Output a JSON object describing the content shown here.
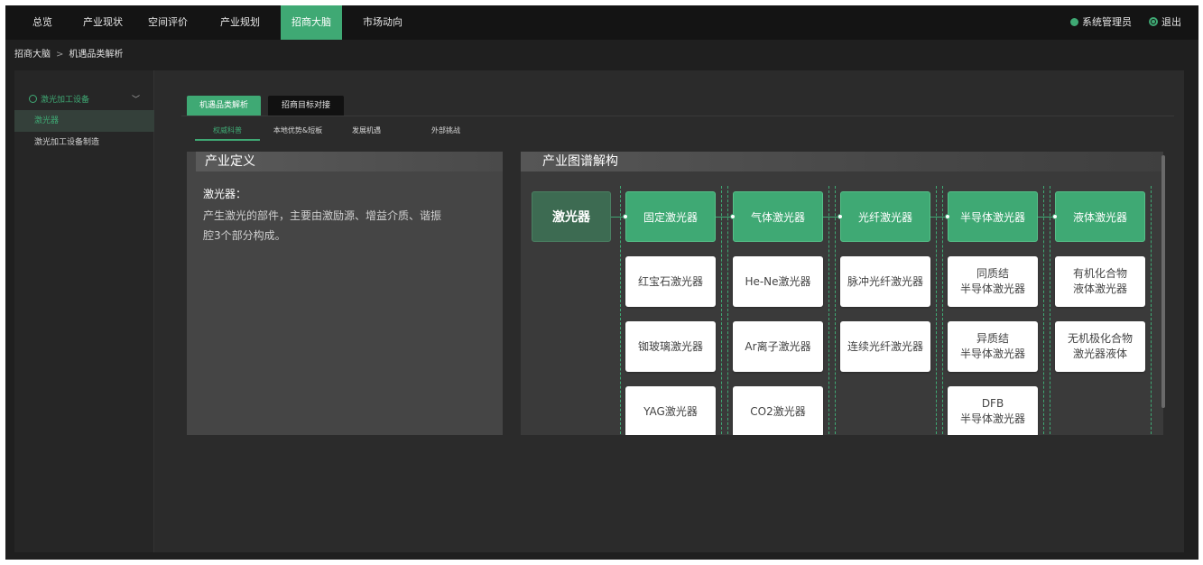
{
  "nav": {
    "items": [
      "总览",
      "产业现状",
      "空间评价",
      "产业规划",
      "招商大脑",
      "市场动向"
    ],
    "active_index": 4,
    "user_label": "系统管理员",
    "logout_label": "退出"
  },
  "breadcrumb": {
    "root": "招商大脑",
    "separator": ">",
    "current": "机遇品类解析"
  },
  "sidebar": {
    "group_label": "激光加工设备",
    "items": [
      "激光器",
      "激光加工设备制造"
    ],
    "active_index": 0
  },
  "tabs": {
    "primary": [
      "机遇品类解析",
      "招商目标对接"
    ],
    "secondary": [
      "权威科普",
      "本地优势&短板",
      "发展机遇",
      "外部挑战"
    ]
  },
  "definition": {
    "title": "产业定义",
    "term": "激光器：",
    "line1": "产生激光的部件，主要由激励源、增益介质、谐振",
    "line2": "腔3个部分构成。"
  },
  "industry_map": {
    "title": "产业图谱解构",
    "root": "激光器",
    "categories": [
      {
        "name": "固定激光器",
        "items": [
          [
            "红宝石激光器"
          ],
          [
            "铷玻璃激光器"
          ],
          [
            "YAG激光器"
          ]
        ]
      },
      {
        "name": "气体激光器",
        "items": [
          [
            "He-Ne激光器"
          ],
          [
            "Ar离子激光器"
          ],
          [
            "CO2激光器"
          ]
        ]
      },
      {
        "name": "光纤激光器",
        "items": [
          [
            "脉冲光纤激光器"
          ],
          [
            "连续光纤激光器"
          ]
        ]
      },
      {
        "name": "半导体激光器",
        "items": [
          [
            "同质结",
            "半导体激光器"
          ],
          [
            "异质结",
            "半导体激光器"
          ],
          [
            "DFB",
            "半导体激光器"
          ]
        ]
      },
      {
        "name": "液体激光器",
        "items": [
          [
            "有机化合物",
            "液体激光器"
          ],
          [
            "无机极化合物",
            "激光器液体"
          ]
        ]
      }
    ]
  },
  "colors": {
    "accent": "#3fa974",
    "background": "#1f1f1f",
    "panel": "#2b2b2b"
  }
}
